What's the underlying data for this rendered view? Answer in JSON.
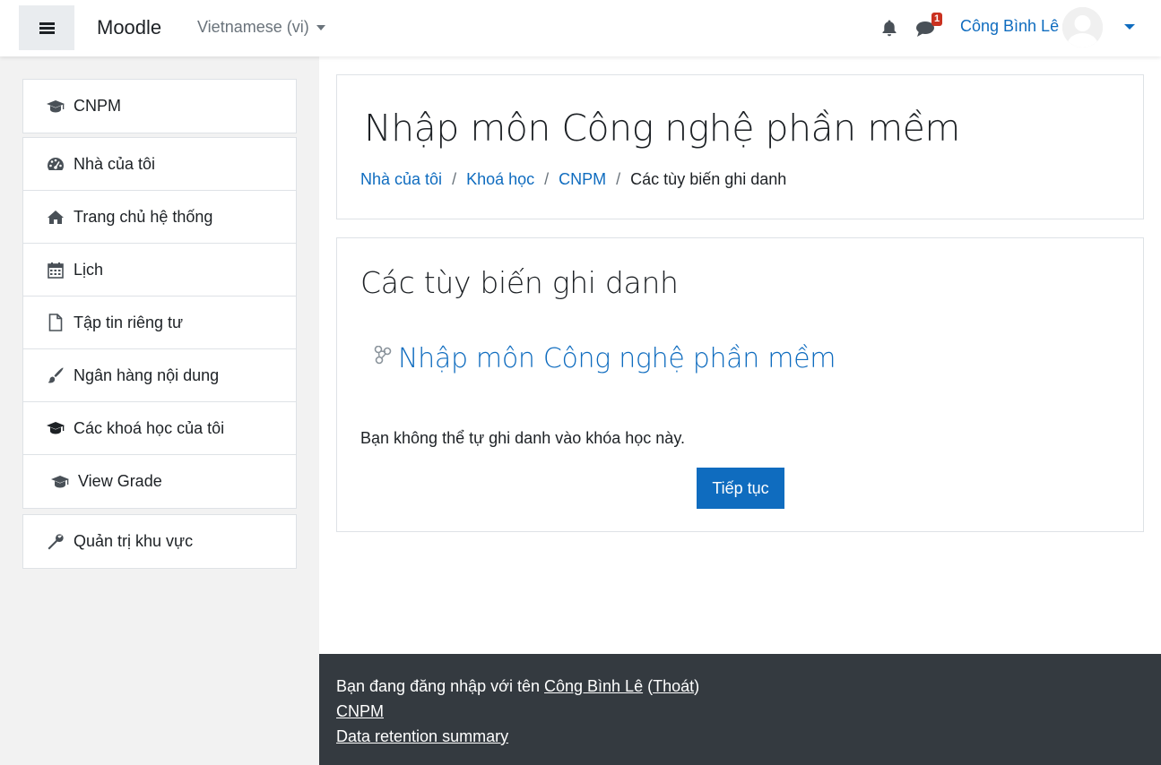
{
  "navbar": {
    "brand": "Moodle",
    "language": "Vietnamese (vi)",
    "message_count": "1",
    "user_name": "Công Bình Lê"
  },
  "sidebar": {
    "course": {
      "label": "CNPM",
      "icon": "graduation-cap-icon"
    },
    "items": [
      {
        "label": "Nhà của tôi",
        "icon": "dashboard-icon"
      },
      {
        "label": "Trang chủ hệ thống",
        "icon": "home-icon"
      },
      {
        "label": "Lịch",
        "icon": "calendar-icon"
      },
      {
        "label": "Tập tin riêng tư",
        "icon": "file-icon"
      },
      {
        "label": "Ngân hàng nội dung",
        "icon": "paint-brush-icon"
      },
      {
        "label": "Các khoá học của tôi",
        "icon": "graduation-cap-icon"
      },
      {
        "label": "View Grade",
        "icon": "graduation-cap-icon"
      }
    ],
    "admin": {
      "label": "Quản trị khu vực",
      "icon": "wrench-icon"
    }
  },
  "header": {
    "title": "Nhập môn Công nghệ phần mềm",
    "breadcrumb": [
      "Nhà của tôi",
      "Khoá học",
      "CNPM",
      "Các tùy biến ghi danh"
    ]
  },
  "content": {
    "section_title": "Các tùy biến ghi danh",
    "course_name": "Nhập môn Công nghệ phần mềm",
    "message": "Bạn không thể tự ghi danh vào khóa học này.",
    "continue_label": "Tiếp tục"
  },
  "footer": {
    "logged_in_prefix": "Bạn đang đăng nhập với tên ",
    "user_name": "Công Bình Lê",
    "logout_label": "Thoát",
    "course_link": "CNPM",
    "data_retention": "Data retention summary"
  },
  "colors": {
    "accent": "#0f6cbf",
    "footer_bg": "#343a40",
    "badge": "#ca3120"
  }
}
